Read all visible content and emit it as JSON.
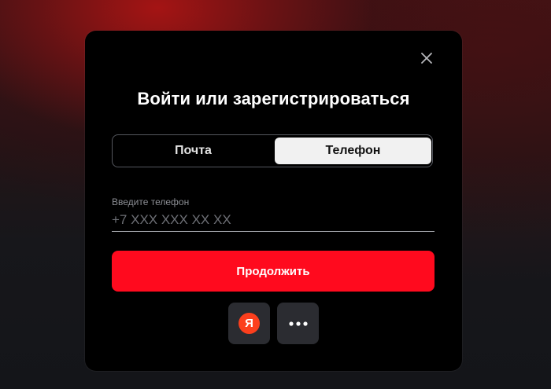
{
  "modal": {
    "title": "Войти или зарегистрироваться",
    "tabs": [
      {
        "label": "Почта",
        "active": false
      },
      {
        "label": "Телефон",
        "active": true
      }
    ],
    "phone_field": {
      "label": "Введите телефон",
      "placeholder": "+7 XXX XXX XX XX",
      "value": ""
    },
    "continue_label": "Продолжить",
    "social": [
      {
        "name": "yandex",
        "icon": "yandex-icon",
        "glyph": "Я",
        "color": "#fc3f1d"
      },
      {
        "name": "more",
        "icon": "more-dots-icon"
      }
    ],
    "close_icon": "close-icon"
  },
  "colors": {
    "accent": "#ff0a1e",
    "modal_bg": "#000000",
    "active_tab_bg": "#f1f1f1",
    "social_bg": "#2b2c31"
  }
}
